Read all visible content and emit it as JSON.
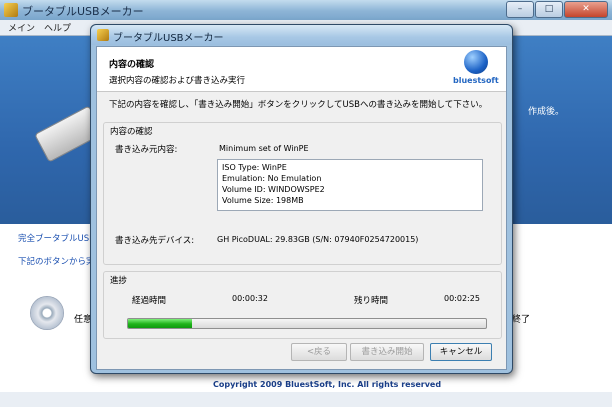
{
  "main_window": {
    "title": "ブータブルUSBメーカー",
    "menu": [
      "メイン",
      "ヘルプ"
    ],
    "banner_text": "作成後。",
    "link1": "完全ブータブルUSB",
    "link2": "下記のボタンから実",
    "option_text_left": "任意",
    "option_text_right": "終了",
    "copyright": "Copyright 2009 BluestSoft, Inc. All rights reserved",
    "window_buttons": [
      "–",
      "□",
      "✕"
    ]
  },
  "dialog": {
    "title": "ブータブルUSBメーカー",
    "header_title": "内容の確認",
    "header_subtitle": "選択内容の確認および書き込み実行",
    "logo_text": "bluestsoft",
    "instruction": "下記の内容を確認し、「書き込み開始」ボタンをクリックしてUSBへの書き込みを開始して下さい。",
    "confirm_group": {
      "title": "内容の確認",
      "source_label": "書き込み元内容:",
      "source_value": "Minimum set of WinPE",
      "details": [
        "ISO Type: WinPE",
        "Emulation: No Emulation",
        "Volume ID: WINDOWSPE2",
        "Volume Size: 198MB"
      ],
      "dest_label": "書き込み先デバイス:",
      "dest_value": "GH PicoDUAL:   29.83GB   (S/N: 07940F0254720015)"
    },
    "progress_group": {
      "title": "進捗",
      "elapsed_label": "経過時間",
      "elapsed_value": "00:00:32",
      "remaining_label": "残り時間",
      "remaining_value": "00:02:25",
      "progress": 0.18
    },
    "buttons": {
      "back": "<戻る",
      "start": "書き込み開始",
      "cancel": "キャンセル"
    }
  }
}
